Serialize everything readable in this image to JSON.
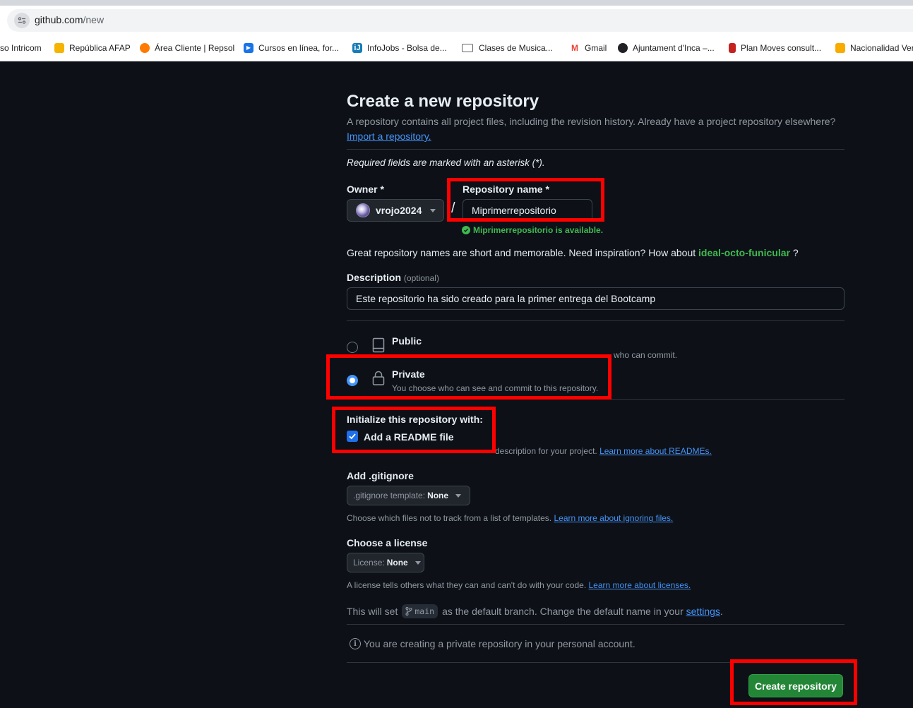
{
  "browser": {
    "url_host": "github.com",
    "url_path": "/new",
    "bookmarks": [
      {
        "label": "so Intricom",
        "color": "#ffffff"
      },
      {
        "label": "República AFAP",
        "color": "#f4b400"
      },
      {
        "label": "Área Cliente | Repsol",
        "color": "#ff7a00"
      },
      {
        "label": "Cursos en línea, for...",
        "color": "#1a73e8"
      },
      {
        "label": "InfoJobs - Bolsa de...",
        "color": "#167db7"
      },
      {
        "label": "Clases de Musica...",
        "color": "folder"
      },
      {
        "label": "Gmail",
        "color": "#ea4335"
      },
      {
        "label": "Ajuntament d'Inca –...",
        "color": "#202124"
      },
      {
        "label": "Plan Moves consult...",
        "color": "#c5221f"
      },
      {
        "label": "Nacionalidad Ver",
        "color": "#f9ab00"
      }
    ]
  },
  "page": {
    "title": "Create a new repository",
    "subtitle": "A repository contains all project files, including the revision history. Already have a project repository elsewhere?",
    "import_link": "Import a repository.",
    "required_note": "Required fields are marked with an asterisk (*).",
    "owner_label": "Owner *",
    "owner_value": "vrojo2024",
    "slash": "/",
    "repo_name_label": "Repository name *",
    "repo_name_value": "Miprimerrepositorio",
    "availability": "Miprimerrepositorio is available.",
    "inspiration_text": "Great repository names are short and memorable. Need inspiration? How about",
    "inspiration_suggestion": "ideal-octo-funicular",
    "inspiration_end": "?",
    "description_label": "Description",
    "description_optional": "(optional)",
    "description_value": "Este repositorio ha sido creado para la primer entrega del Bootcamp",
    "public_title": "Public",
    "public_desc_visible": "who can commit.",
    "private_title": "Private",
    "private_desc": "You choose who can see and commit to this repository.",
    "init_label": "Initialize this repository with:",
    "readme_label": "Add a README file",
    "readme_desc_visible": "description for your project.",
    "readme_link": "Learn more about READMEs.",
    "gitignore_label": "Add .gitignore",
    "gitignore_select_prefix": ".gitignore template:",
    "gitignore_select_value": "None",
    "gitignore_note": "Choose which files not to track from a list of templates.",
    "gitignore_link": "Learn more about ignoring files.",
    "license_label": "Choose a license",
    "license_select_prefix": "License:",
    "license_select_value": "None",
    "license_note": "A license tells others what they can and can't do with your code.",
    "license_link": "Learn more about licenses.",
    "branch_pre": "This will set",
    "branch_name": "main",
    "branch_post": "as the default branch. Change the default name in your",
    "branch_link": "settings",
    "branch_end": ".",
    "info_note": "You are creating a private repository in your personal account.",
    "create_button": "Create repository"
  },
  "colors": {
    "background": "#0d1117",
    "accent_blue": "#4493f8",
    "success_green": "#3fb950",
    "create_button": "#238636",
    "highlight": "#ff0000"
  }
}
